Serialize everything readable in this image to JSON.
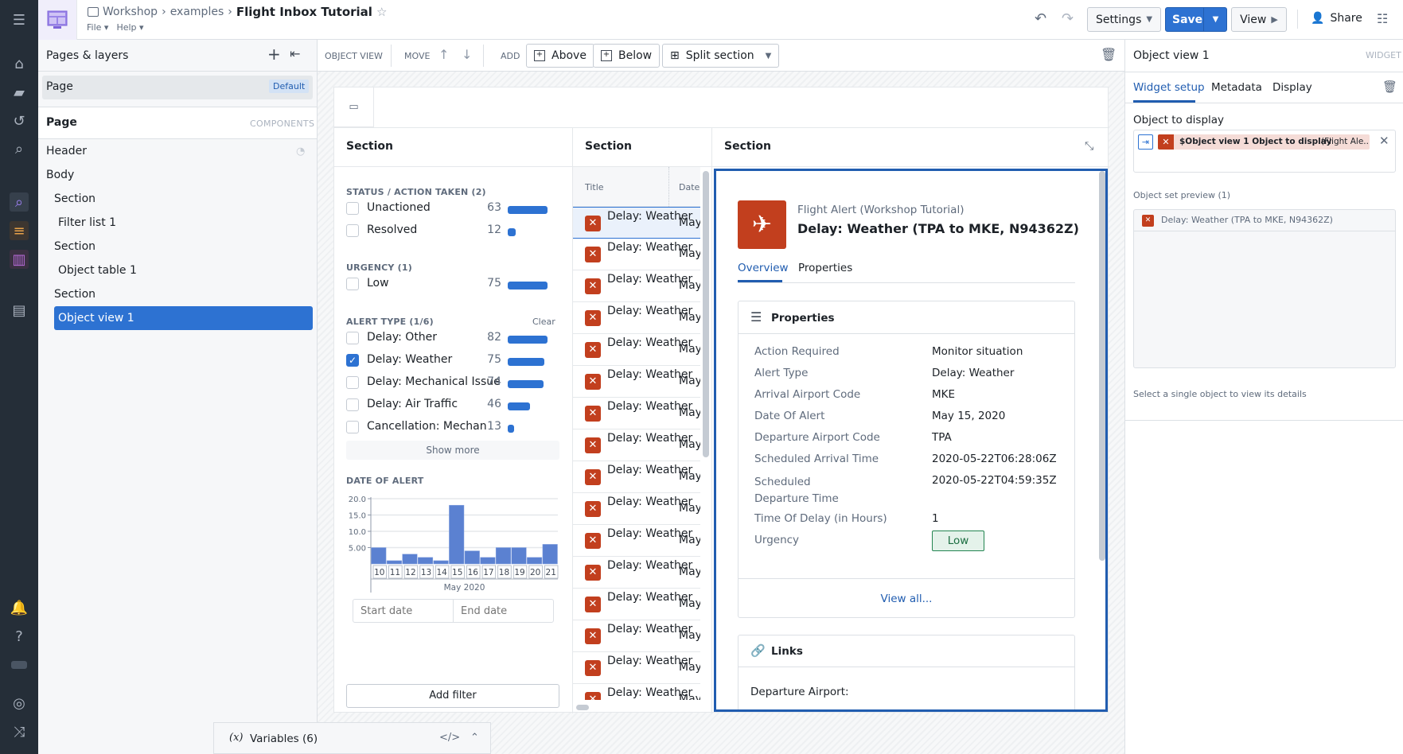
{
  "topbar": {
    "breadcrumb": [
      "Workshop",
      "examples"
    ],
    "title": "Flight Inbox Tutorial",
    "menus": [
      "File",
      "Help"
    ],
    "settings_label": "Settings",
    "save_label": "Save",
    "view_label": "View",
    "share_label": "Share"
  },
  "left_panel": {
    "title": "Pages & layers",
    "page_item": "Page",
    "page_badge": "Default",
    "components_title": "Page",
    "components_label": "COMPONENTS",
    "tree": [
      {
        "label": "Header"
      },
      {
        "label": "Body"
      },
      {
        "label": "Section"
      },
      {
        "label": "Filter list 1"
      },
      {
        "label": "Section"
      },
      {
        "label": "Object table 1"
      },
      {
        "label": "Section"
      },
      {
        "label": "Object view 1",
        "selected": true
      }
    ]
  },
  "toolbar": {
    "object_view": "OBJECT VIEW",
    "move": "MOVE",
    "add": "ADD",
    "above": "Above",
    "below": "Below",
    "split_section": "Split section"
  },
  "sections": {
    "filter_title": "Section",
    "table_title": "Section",
    "view_title": "Section"
  },
  "filter_list": {
    "groups": [
      {
        "title": "STATUS / ACTION TAKEN (2)",
        "items": [
          {
            "label": "Unactioned",
            "count": 63,
            "checked": false
          },
          {
            "label": "Resolved",
            "count": 12,
            "checked": false
          }
        ]
      },
      {
        "title": "URGENCY (1)",
        "items": [
          {
            "label": "Low",
            "count": 75,
            "checked": false
          }
        ]
      },
      {
        "title": "ALERT TYPE (1/6)",
        "clear": "Clear",
        "items": [
          {
            "label": "Delay: Other",
            "count": 82,
            "checked": false
          },
          {
            "label": "Delay: Weather",
            "count": 75,
            "checked": true
          },
          {
            "label": "Delay: Mechanical Issue",
            "count": 74,
            "checked": false
          },
          {
            "label": "Delay: Air Traffic",
            "count": 46,
            "checked": false
          },
          {
            "label": "Cancellation: Mechanical...",
            "count": 13,
            "checked": false
          }
        ]
      }
    ],
    "show_more": "Show more",
    "date_title": "DATE OF ALERT",
    "start_placeholder": "Start date",
    "end_placeholder": "End date",
    "add_filter": "Add filter"
  },
  "chart_data": {
    "type": "bar",
    "title": "DATE OF ALERT",
    "categories": [
      "10",
      "11",
      "12",
      "13",
      "14",
      "15",
      "16",
      "17",
      "18",
      "19",
      "20",
      "21"
    ],
    "values": [
      5,
      1,
      3,
      2,
      1,
      18,
      4,
      2,
      5,
      5,
      2,
      6
    ],
    "xlabel": "May 2020",
    "ylabel": "",
    "yticks": [
      "5.00",
      "10.0",
      "15.0",
      "20.0"
    ],
    "ylim": [
      0,
      20
    ],
    "grid": true
  },
  "table": {
    "columns": [
      "Title",
      "Date"
    ],
    "rows": [
      {
        "title": "Delay: Weather",
        "date": "May"
      },
      {
        "title": "Delay: Weather",
        "date": "May"
      },
      {
        "title": "Delay: Weather",
        "date": "May"
      },
      {
        "title": "Delay: Weather",
        "date": "May"
      },
      {
        "title": "Delay: Weather",
        "date": "May"
      },
      {
        "title": "Delay: Weather",
        "date": "May"
      },
      {
        "title": "Delay: Weather",
        "date": "May"
      },
      {
        "title": "Delay: Weather",
        "date": "May"
      },
      {
        "title": "Delay: Weather",
        "date": "May"
      },
      {
        "title": "Delay: Weather",
        "date": "May"
      },
      {
        "title": "Delay: Weather",
        "date": "May"
      },
      {
        "title": "Delay: Weather",
        "date": "May"
      },
      {
        "title": "Delay: Weather",
        "date": "May"
      },
      {
        "title": "Delay: Weather",
        "date": "May"
      },
      {
        "title": "Delay: Weather",
        "date": "May"
      },
      {
        "title": "Delay: Weather",
        "date": "May"
      }
    ]
  },
  "object_view": {
    "type_label": "Flight Alert (Workshop Tutorial)",
    "title": "Delay: Weather (TPA to MKE, N94362Z)",
    "tabs": [
      "Overview",
      "Properties"
    ],
    "properties_title": "Properties",
    "properties": [
      {
        "key": "Action Required",
        "value": "Monitor situation"
      },
      {
        "key": "Alert Type",
        "value": "Delay: Weather"
      },
      {
        "key": "Arrival Airport Code",
        "value": "MKE"
      },
      {
        "key": "Date Of Alert",
        "value": "May 15, 2020"
      },
      {
        "key": "Departure Airport Code",
        "value": "TPA"
      },
      {
        "key": "Scheduled Arrival Time",
        "value": "2020-05-22T06:28:06Z"
      },
      {
        "key": "Scheduled Departure Time",
        "value": "2020-05-22T04:59:35Z"
      },
      {
        "key": "Time Of Delay (in Hours)",
        "value": "1"
      },
      {
        "key": "Urgency",
        "value": "Low"
      }
    ],
    "view_all": "View all...",
    "links_title": "Links",
    "departure_airport": "Departure Airport:"
  },
  "variables": {
    "label": "Variables (6)"
  },
  "right_panel": {
    "title": "Object view 1",
    "kind": "WIDGET",
    "tabs": [
      "Widget setup",
      "Metadata",
      "Display"
    ],
    "object_to_display_label": "Object to display",
    "variable_chip": "$Object view 1 Object to display",
    "variable_chip_suffix": "(Flight Ale...",
    "preview_label": "Object set preview (1)",
    "preview_item": "Delay: Weather (TPA to MKE, N94362Z)",
    "hint": "Select a single object to view its details"
  },
  "colors": {
    "accent": "#2d72d2",
    "brand_red": "#c23f1e",
    "save": "#2d72d2"
  }
}
